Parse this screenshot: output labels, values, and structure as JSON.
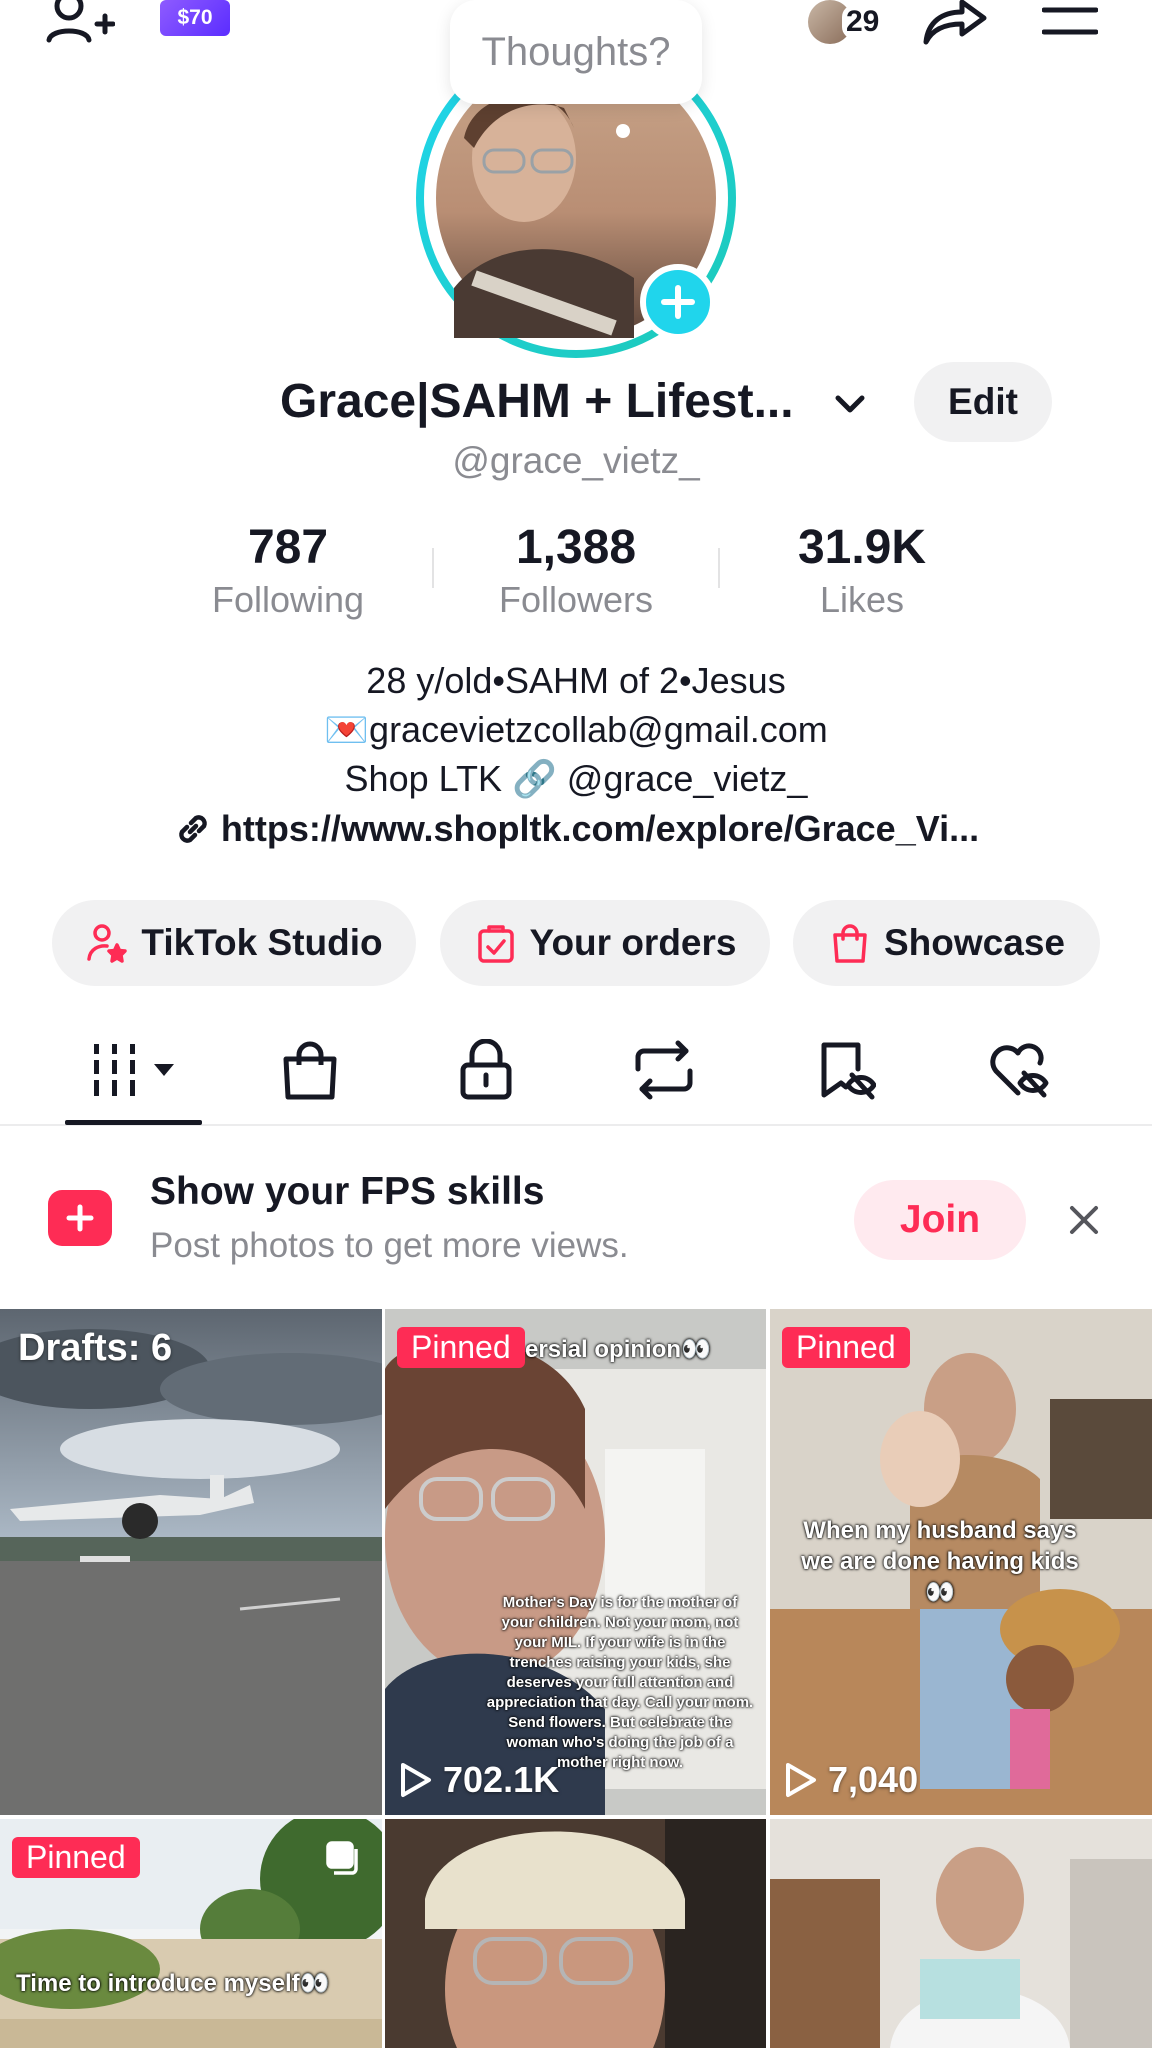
{
  "topbar": {
    "coupon_label": "$70",
    "friends_count": "29"
  },
  "profile": {
    "thought_bubble": "Thoughts?",
    "display_name": "Grace|SAHM + Lifest...",
    "username": "@grace_vietz_",
    "edit_label": "Edit"
  },
  "stats": {
    "following": {
      "value": "787",
      "label": "Following"
    },
    "followers": {
      "value": "1,388",
      "label": "Followers"
    },
    "likes": {
      "value": "31.9K",
      "label": "Likes"
    }
  },
  "bio": {
    "line1": "28 y/old•SAHM of 2•Jesus",
    "line2": "💌gracevietzcollab@gmail.com",
    "line3": "Shop LTK 🔗 @grace_vietz_",
    "link": "https://www.shopltk.com/explore/Grace_Vi..."
  },
  "actions": {
    "studio": "TikTok Studio",
    "orders": "Your orders",
    "showcase": "Showcase"
  },
  "promo": {
    "title": "Show your FPS skills",
    "subtitle": "Post photos to get more views.",
    "join_label": "Join"
  },
  "grid": {
    "drafts_label": "Drafts: 6",
    "pinned_label": "Pinned",
    "video2": {
      "top_caption": "ersial opinion👀",
      "caption": "Mother's Day is for the mother of your children. Not your mom, not your MIL. If your wife is in the trenches raising your kids, she deserves your full attention and appreciation that day. Call your mom. Send flowers. But celebrate the woman who's doing the job of a mother right now.",
      "views": "702.1K"
    },
    "video3": {
      "caption": "When my husband says we are done having kids👀",
      "views": "7,040"
    },
    "video4": {
      "caption": "Time to introduce myself👀"
    }
  },
  "colors": {
    "brand_red": "#fe2c55",
    "story_cyan": "#20d5ec",
    "text_primary": "#161823",
    "text_secondary": "#8a8b91"
  }
}
